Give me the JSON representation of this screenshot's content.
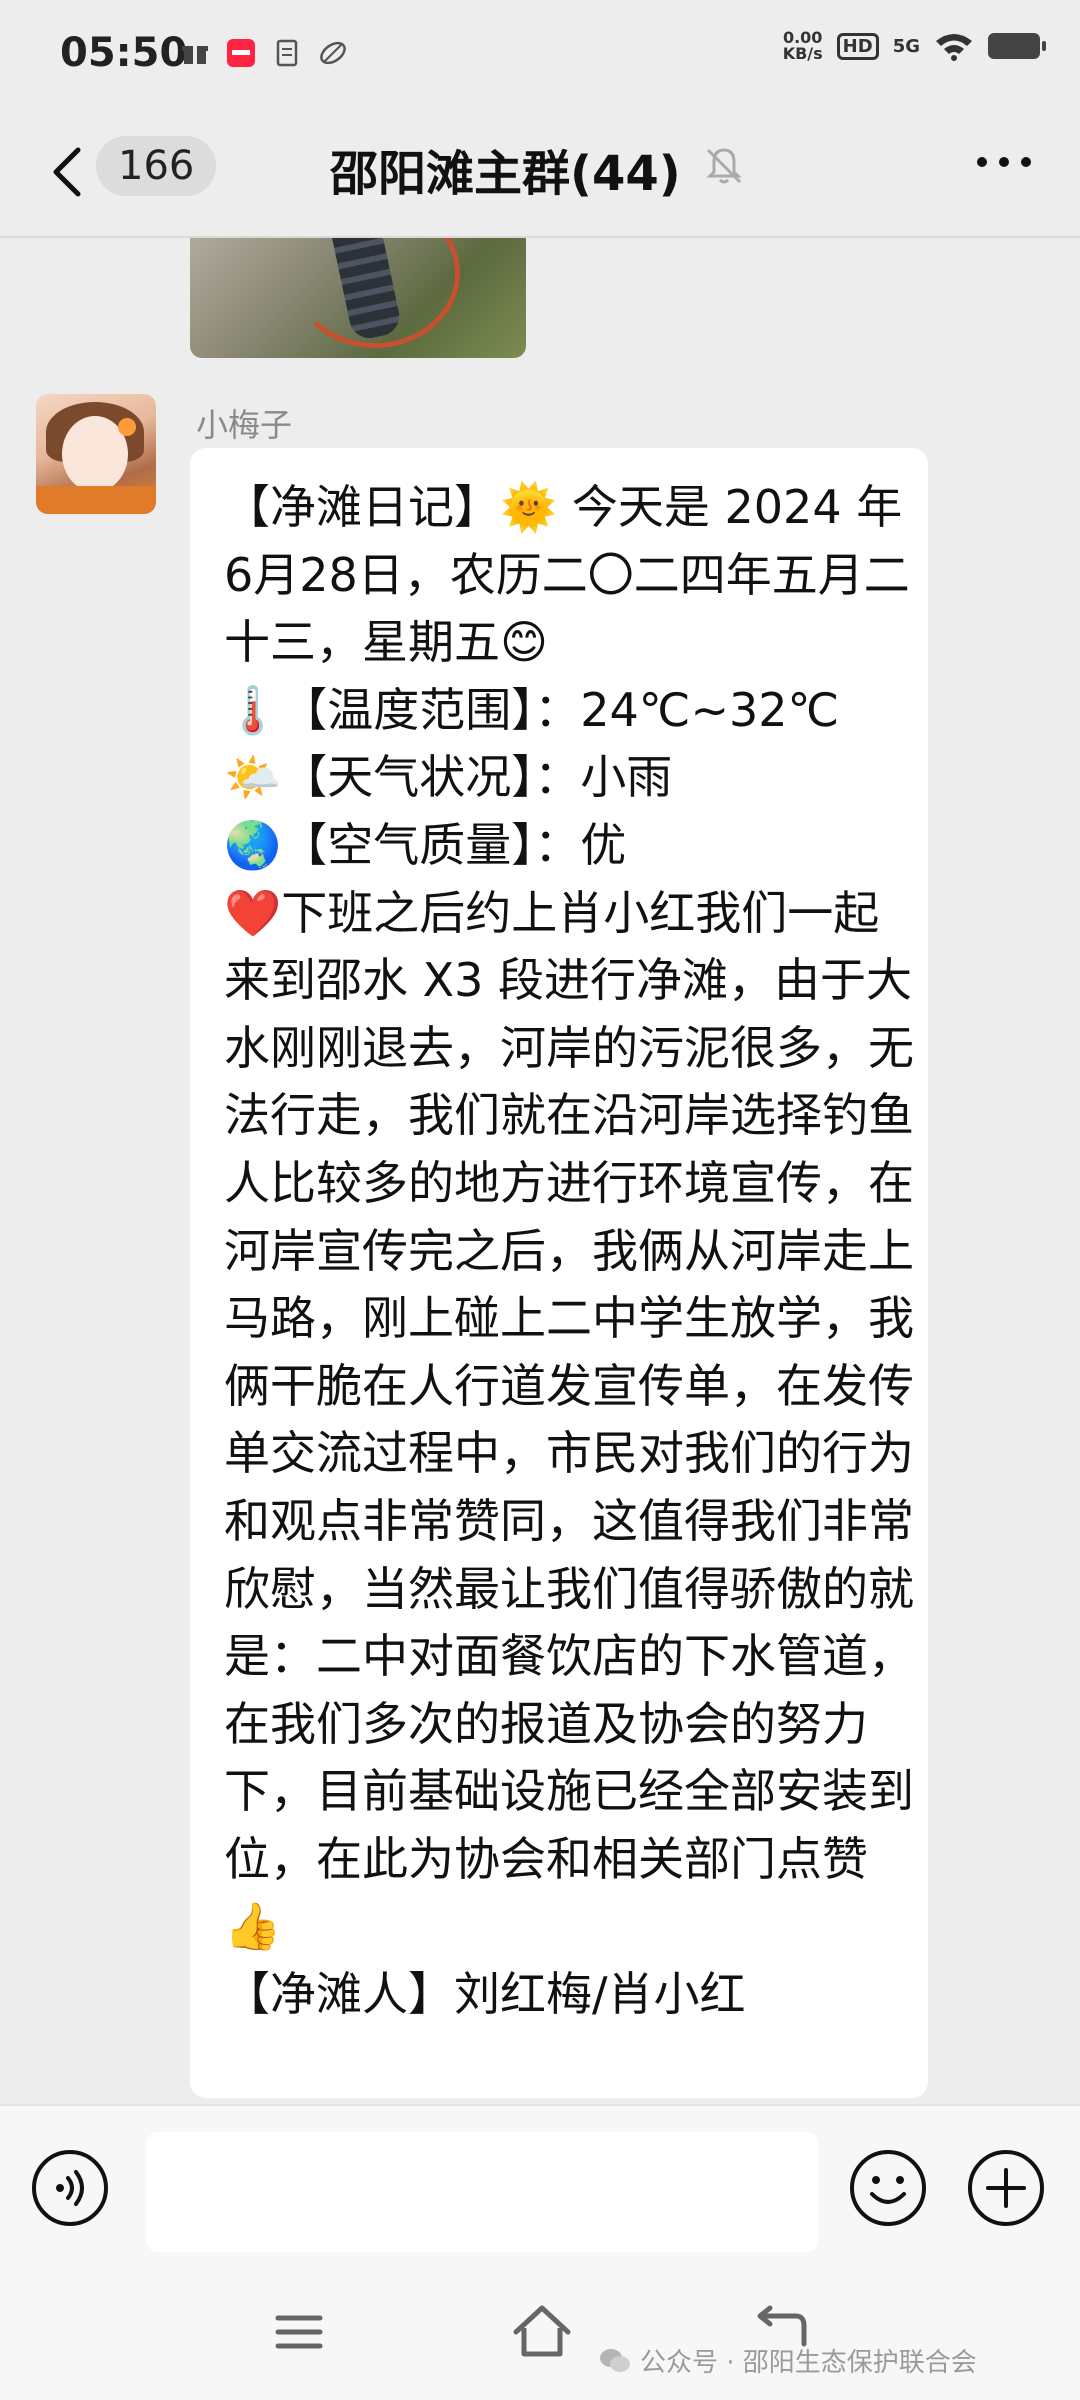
{
  "status_bar": {
    "time": "05:50",
    "net_speed_value": "0.00",
    "net_speed_unit": "KB/s",
    "hd_label": "HD",
    "network_label": "5G"
  },
  "nav": {
    "unread_count": "166",
    "title": "邵阳滩主群(44)"
  },
  "message": {
    "sender": "小梅子",
    "text": "【净滩日记】🌞 今天是 2024 年6月28日，农历二〇二四年五月二十三，星期五😊\n🌡️【温度范围】：24℃~32℃\n🌤️【天气状况】：小雨\n🌏【空气质量】：优\n❤️下班之后约上肖小红我们一起来到邵水 X3 段进行净滩，由于大水刚刚退去，河岸的污泥很多，无法行走，我们就在沿河岸选择钓鱼人比较多的地方进行环境宣传，在河岸宣传完之后，我俩从河岸走上马路，刚上碰上二中学生放学，我俩干脆在人行道发宣传单，在发传单交流过程中，市民对我们的行为和观点非常赞同，这值得我们非常欣慰，当然最让我们值得骄傲的就是：二中对面餐饮店的下水管道，在我们多次的报道及协会的努力下，目前基础设施已经全部安装到位，在此为协会和相关部门点赞👍\n【净滩人】刘红梅/肖小红"
  },
  "input": {
    "placeholder": ""
  },
  "watermark": {
    "text": "公众号 · 邵阳生态保护联合会"
  },
  "colors": {
    "background": "#ededed",
    "bubble": "#ffffff",
    "input_bar": "#f7f7f7"
  }
}
